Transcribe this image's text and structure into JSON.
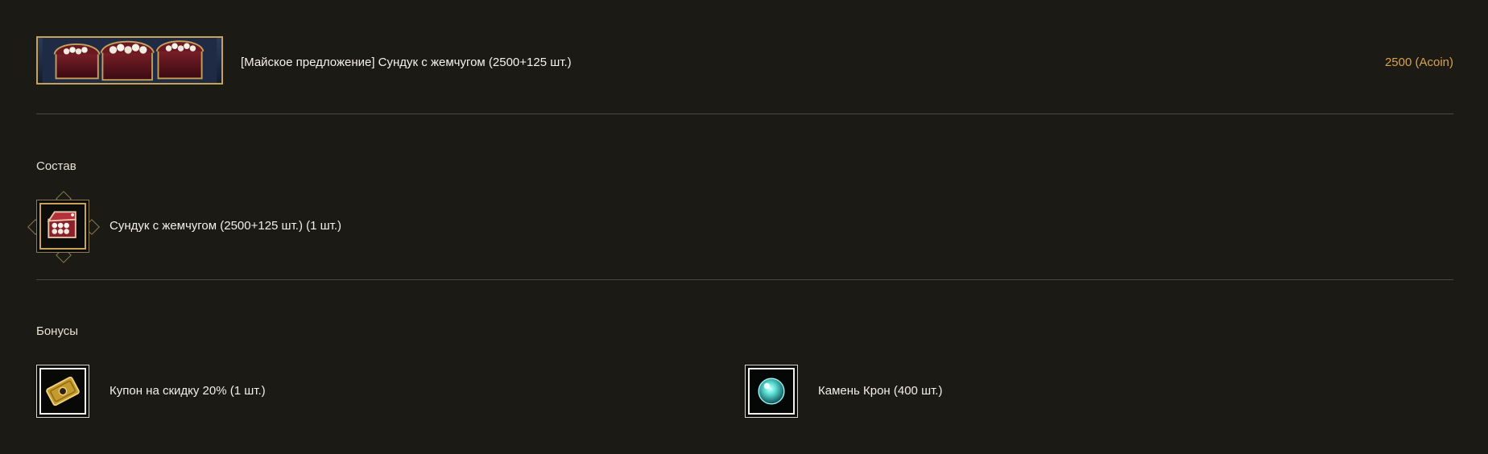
{
  "product": {
    "thumbnail_icon": "pearl-chest-image",
    "title": "[Майское предложение] Сундук с жемчугом (2500+125 шт.)",
    "price": "2500 (Acoin)"
  },
  "composition": {
    "title": "Состав",
    "items": [
      {
        "icon": "pearl-chest-icon",
        "label": "Сундук с жемчугом (2500+125 шт.) (1 шт.)"
      }
    ]
  },
  "bonuses": {
    "title": "Бонусы",
    "items": [
      {
        "icon": "discount-coupon-icon",
        "label": "Купон на скидку 20% (1 шт.)"
      },
      {
        "icon": "crown-stone-icon",
        "label": "Камень Крон (400 шт.)"
      }
    ]
  },
  "colors": {
    "background": "#1b1a14",
    "accent_gold": "#c6a15a",
    "price_color": "#d9a24a",
    "divider": "#4b4a3f"
  }
}
